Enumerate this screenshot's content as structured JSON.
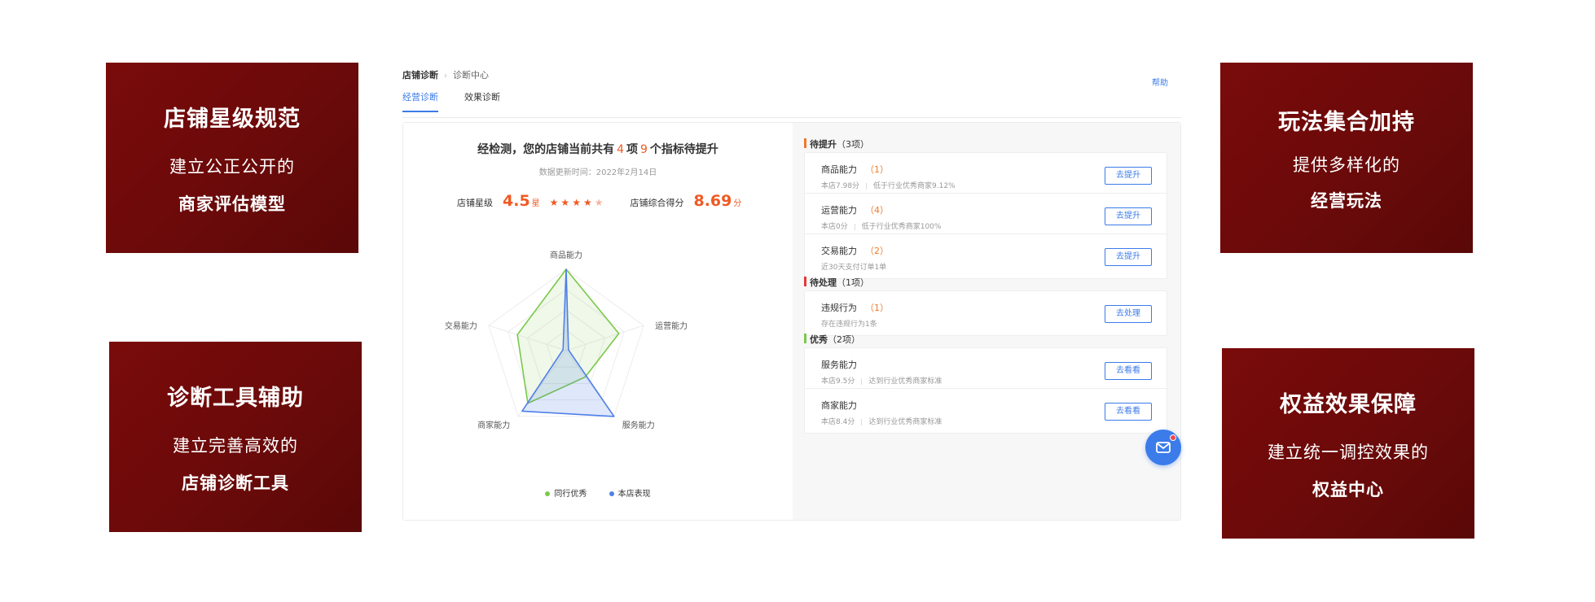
{
  "cards": [
    {
      "title": "店铺星级规范",
      "line1": "建立公正公开的",
      "line2": "商家评估模型"
    },
    {
      "title": "玩法集合加持",
      "line1": "提供多样化的",
      "line2": "经营玩法"
    },
    {
      "title": "诊断工具辅助",
      "line1": "建立完善高效的",
      "line2": "店铺诊断工具"
    },
    {
      "title": "权益效果保障",
      "line1": "建立统一调控效果的",
      "line2": "权益中心"
    }
  ],
  "breadcrumb": {
    "root": "店铺诊断",
    "current": "诊断中心"
  },
  "help_label": "帮助",
  "tabs": [
    {
      "label": "经营诊断"
    },
    {
      "label": "效果诊断"
    }
  ],
  "summary": {
    "prefix": "经检测，您的店铺当前共有",
    "count_items": "4",
    "middle": "项",
    "count_metrics": "9",
    "suffix": "个指标待提升",
    "updated": "数据更新时间：2022年2月14日",
    "star_label": "店铺星级",
    "star_value": "4.5",
    "star_unit": "星",
    "stars": "★★★★",
    "stars_half": "★",
    "score_label": "店铺综合得分",
    "score_value": "8.69",
    "score_unit": "分"
  },
  "radar": {
    "axes": [
      "商品能力",
      "运营能力",
      "服务能力",
      "商家能力",
      "交易能力"
    ],
    "max": 10,
    "series": [
      {
        "name": "同行优秀",
        "color": "#7bc94a",
        "values": [
          10,
          6.8,
          4,
          8.0,
          6.3
        ]
      },
      {
        "name": "本店表现",
        "color": "#4f7fe8",
        "values": [
          10,
          0.3,
          10,
          9.2,
          0.4
        ]
      }
    ]
  },
  "sections": [
    {
      "title": "待提升",
      "count": "（3项）"
    },
    {
      "title": "待处理",
      "count": "（1项）"
    },
    {
      "title": "优秀",
      "count": "（2项）"
    }
  ],
  "items": [
    {
      "title": "商品能力",
      "num": "（1）",
      "sub1": "本店7.98分",
      "sub2": "低于行业优秀商家9.12%",
      "button": "去提升"
    },
    {
      "title": "运营能力",
      "num": "（4）",
      "sub1": "本店0分",
      "sub2": "低于行业优秀商家100%",
      "button": "去提升"
    },
    {
      "title": "交易能力",
      "num": "（2）",
      "sub1": "近30天支付订单1单",
      "sub2": "",
      "button": "去提升"
    },
    {
      "title": "违规行为",
      "num": "（1）",
      "sub1": "存在违规行为1条",
      "sub2": "",
      "button": "去处理"
    },
    {
      "title": "服务能力",
      "num": "",
      "sub1": "本店9.5分",
      "sub2": "达到行业优秀商家标准",
      "button": "去看看"
    },
    {
      "title": "商家能力",
      "num": "",
      "sub1": "本店8.4分",
      "sub2": "达到行业优秀商家标准",
      "button": "去看看"
    }
  ],
  "float_icon": "mail-icon",
  "colors": {
    "brand_red": "#6b0a0a",
    "accent_blue": "#3b7bea",
    "accent_orange": "#f05a24"
  }
}
